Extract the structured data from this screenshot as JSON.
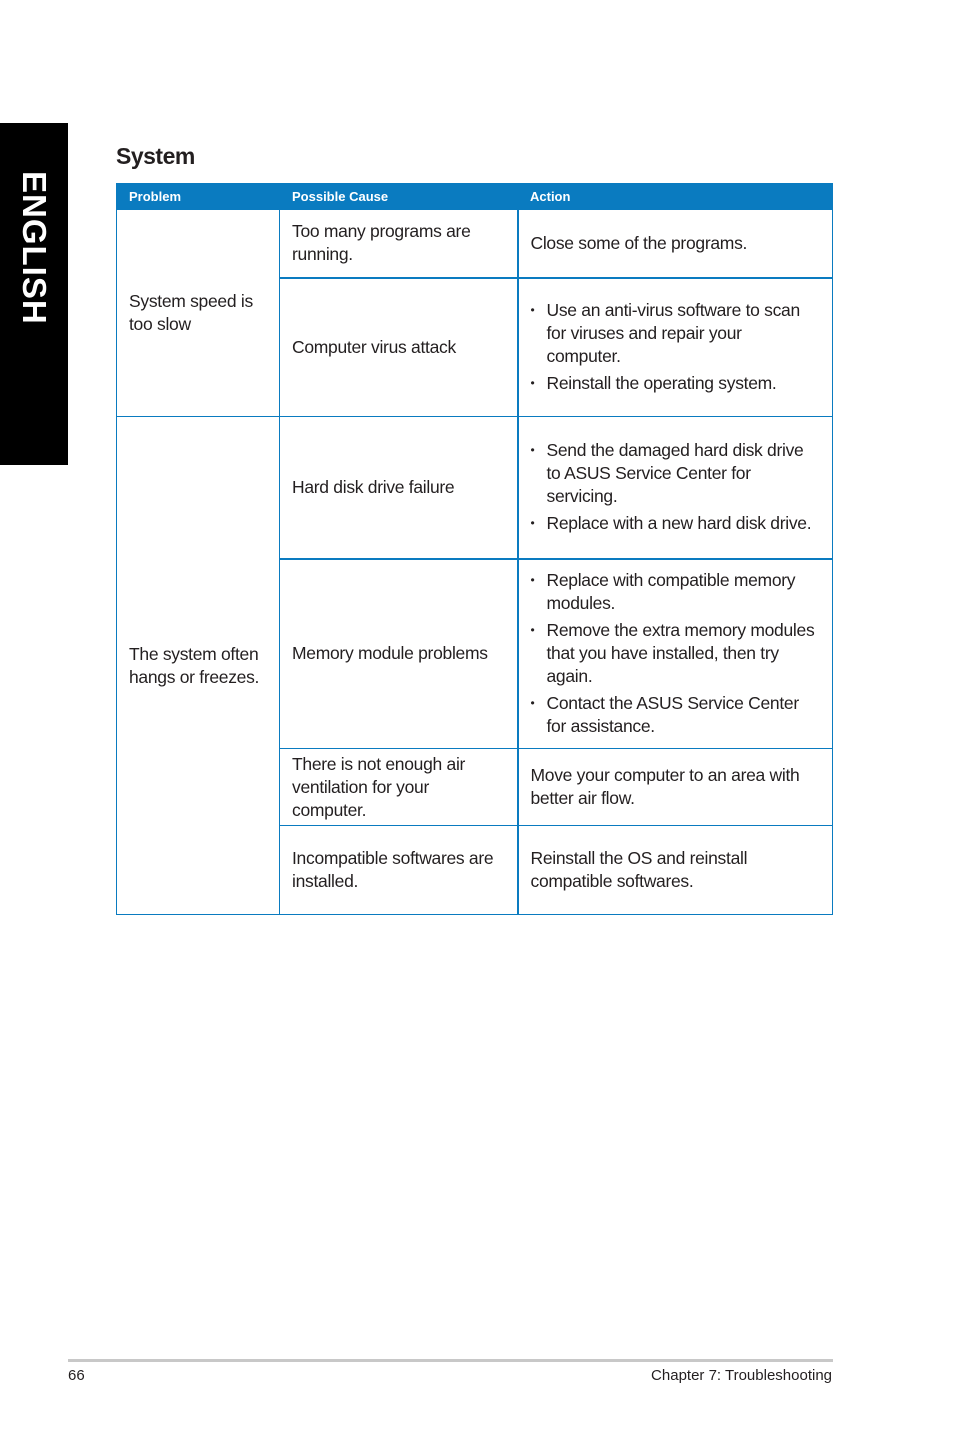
{
  "side_tab": {
    "label": "ENGLISH"
  },
  "section": {
    "title": "System"
  },
  "table": {
    "headers": [
      "Problem",
      "Possible Cause",
      "Action"
    ],
    "groups": [
      {
        "problem": "System speed is too slow",
        "rows": [
          {
            "cause": "Too many programs are running.",
            "action_text": "Close some of the programs.",
            "action_bullets": []
          },
          {
            "cause": "Computer virus attack",
            "action_text": "",
            "action_bullets": [
              "Use an anti-virus software to scan for viruses and repair your computer.",
              "Reinstall the operating system."
            ]
          }
        ]
      },
      {
        "problem": "The system often hangs or freezes.",
        "rows": [
          {
            "cause": "Hard disk drive failure",
            "action_text": "",
            "action_bullets": [
              "Send the damaged hard disk drive to ASUS Service Center for servicing.",
              "Replace with a new hard disk drive."
            ]
          },
          {
            "cause": "Memory module problems",
            "action_text": "",
            "action_bullets": [
              "Replace with compatible memory modules.",
              "Remove the extra memory modules that you have installed, then try again.",
              "Contact the ASUS Service Center for assistance."
            ]
          },
          {
            "cause": "There is not enough air ventilation for your computer.",
            "action_text": "Move your computer to an area with better air flow.",
            "action_bullets": []
          },
          {
            "cause": "Incompatible softwares are installed.",
            "action_text": "Reinstall the OS and reinstall compatible softwares.",
            "action_bullets": []
          }
        ]
      }
    ]
  },
  "footer": {
    "page_number": "66",
    "chapter": "Chapter 7: Troubleshooting"
  },
  "colors": {
    "accent": "#0a7bc0",
    "side_tab": "#000000"
  }
}
